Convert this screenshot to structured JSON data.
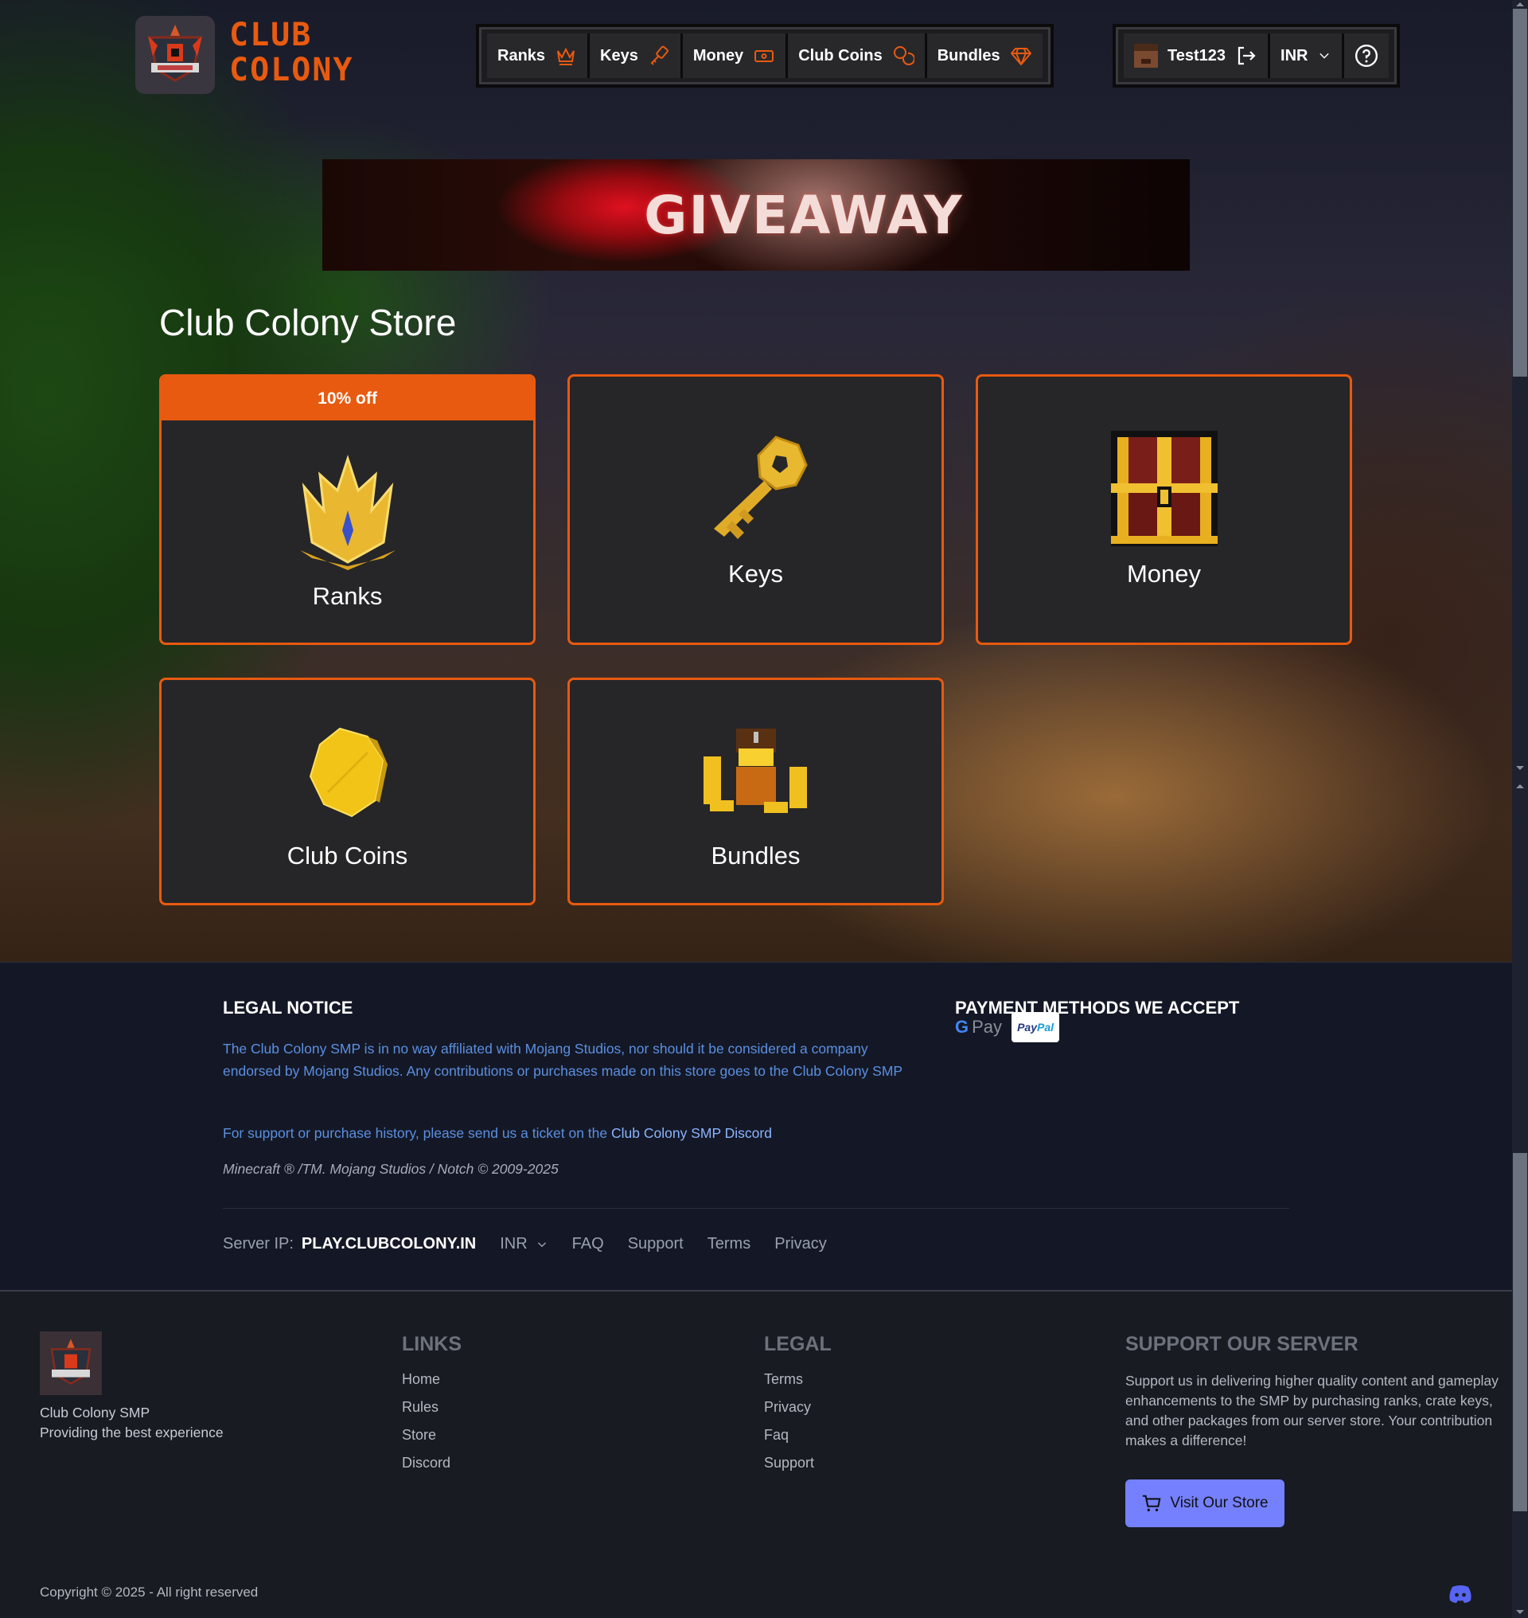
{
  "header": {
    "brand_line1": "CLUB",
    "brand_line2": "COLONY",
    "nav": [
      {
        "label": "Ranks",
        "icon": "crown-icon"
      },
      {
        "label": "Keys",
        "icon": "key-icon"
      },
      {
        "label": "Money",
        "icon": "cash-icon"
      },
      {
        "label": "Club Coins",
        "icon": "coins-icon"
      },
      {
        "label": "Bundles",
        "icon": "diamond-icon"
      }
    ],
    "user": {
      "username": "Test123",
      "logout_icon": "logout-icon"
    },
    "currency": "INR",
    "help_icon": "help-circle-icon",
    "accent_color": "#e85a10"
  },
  "banner": {
    "text": "GIVEAWAY"
  },
  "store": {
    "title": "Club Colony Store",
    "categories": [
      {
        "label": "Ranks",
        "badge": "10% off",
        "icon": "crown-art"
      },
      {
        "label": "Keys",
        "icon": "key-art"
      },
      {
        "label": "Money",
        "icon": "chest-art"
      },
      {
        "label": "Club Coins",
        "icon": "coin-art"
      },
      {
        "label": "Bundles",
        "icon": "treasure-art"
      }
    ]
  },
  "legal": {
    "title": "LEGAL NOTICE",
    "text": "The Club Colony SMP is in no way affiliated with Mojang Studios, nor should it be considered a company endorsed by Mojang Studios. Any contributions or purchases made on this store goes to the Club Colony SMP",
    "support_prefix": "For support or purchase history, please send us a ticket on the ",
    "support_link": "Club Colony SMP Discord",
    "trademark": "Minecraft ® /TM. Mojang Studios / Notch © 2009-2025",
    "payments_title": "PAYMENT METHODS WE ACCEPT",
    "payments": [
      "G Pay",
      "PayPal"
    ],
    "server_ip_label": "Server IP:",
    "server_ip": "PLAY.CLUBCOLONY.IN",
    "currency": "INR",
    "links": [
      "FAQ",
      "Support",
      "Terms",
      "Privacy"
    ]
  },
  "footer": {
    "name": "Club Colony SMP",
    "tagline": "Providing the best experience",
    "links_title": "LINKS",
    "links": [
      "Home",
      "Rules",
      "Store",
      "Discord"
    ],
    "legal_title": "LEGAL",
    "legal_links": [
      "Terms",
      "Privacy",
      "Faq",
      "Support"
    ],
    "support_title": "SUPPORT OUR SERVER",
    "support_text": "Support us in delivering higher quality content and gameplay enhancements to the SMP by purchasing ranks, crate keys, and other packages from our server store. Your contribution makes a difference!",
    "visit_button": "Visit Our Store",
    "copyright": "Copyright © 2025 - All right reserved",
    "button_color": "#7580ff"
  }
}
